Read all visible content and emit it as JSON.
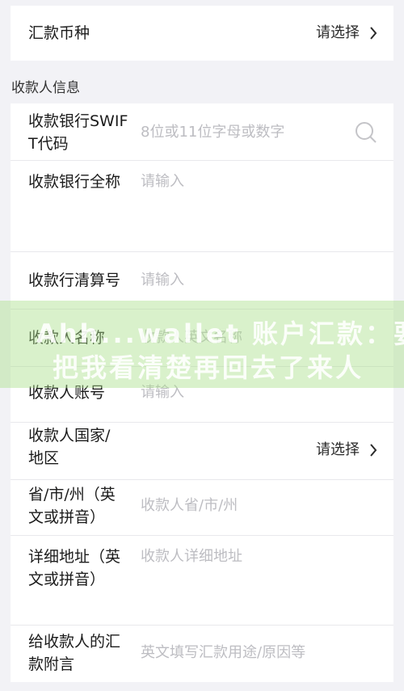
{
  "currency": {
    "label": "汇款币种",
    "value": "请选择"
  },
  "section": {
    "title": "收款人信息"
  },
  "fields": {
    "swift": {
      "label": "收款银行SWIFT代码",
      "placeholder": "8位或11位字母或数字"
    },
    "bank_name": {
      "label": "收款银行全称",
      "placeholder": "请输入"
    },
    "clearing": {
      "label": "收款行清算号",
      "placeholder": "请输入"
    },
    "payee_name": {
      "label": "收款人名称",
      "placeholder": "收款人英文名称"
    },
    "account": {
      "label": "收款人账号",
      "placeholder": "请输入"
    },
    "country": {
      "label": "收款人国家/地区",
      "value": "请选择"
    },
    "province": {
      "label": "省/市/州（英文或拼音）",
      "placeholder": "收款人省/市/州"
    },
    "address": {
      "label": "详细地址（英文或拼音）",
      "placeholder": "收款人详细地址"
    },
    "remark": {
      "label": "给收款人的汇款附言",
      "placeholder": "英文填写汇款用途/原因等"
    }
  },
  "icons": {
    "search": "search-icon",
    "chevron": "chevron-right-icon"
  },
  "watermark": {
    "line1": "Ahh...wallet 账户汇款：要",
    "line2": "把我看清楚再回去了来人"
  }
}
